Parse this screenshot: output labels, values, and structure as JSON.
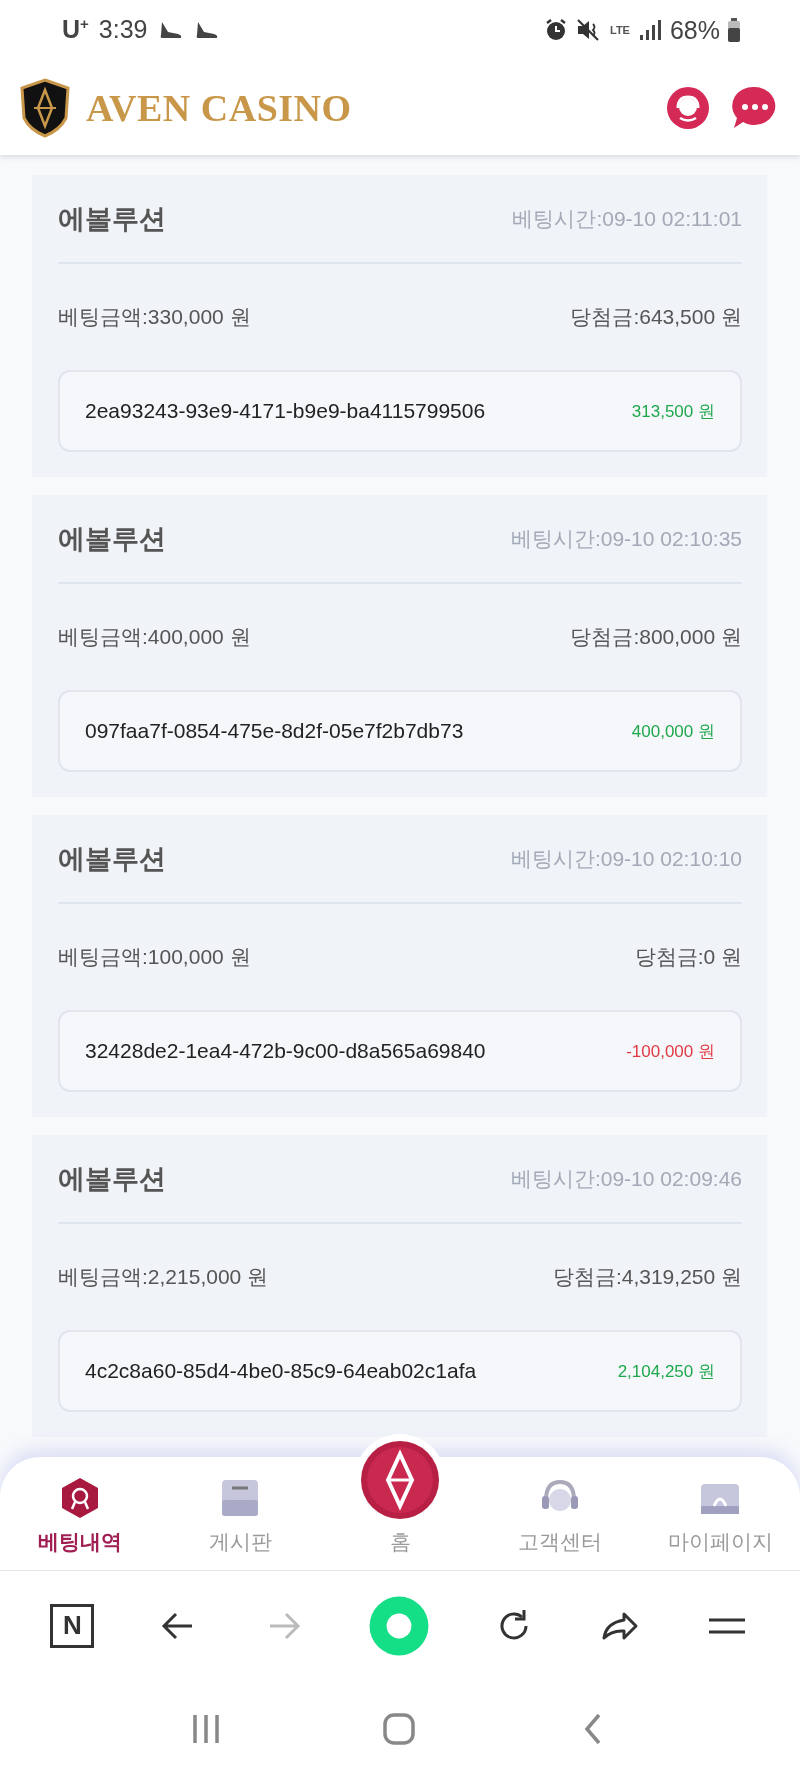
{
  "status_bar": {
    "carrier": "U$^{+}$",
    "time": "3:39",
    "network": "LTE",
    "battery": "68%"
  },
  "header": {
    "title": "AVEN CASINO"
  },
  "bets": [
    {
      "game": "에볼루션",
      "time": "베팅시간:09-10 02:11:01",
      "stake": "베팅금액:330,000 원",
      "payout": "당첨금:643,500 원",
      "round_id": "2ea93243-93e9-4171-b9e9-ba4115799506",
      "profit": "313,500 원",
      "kind": "gain"
    },
    {
      "game": "에볼루션",
      "time": "베팅시간:09-10 02:10:35",
      "stake": "베팅금액:400,000 원",
      "payout": "당첨금:800,000 원",
      "round_id": "097faa7f-0854-475e-8d2f-05e7f2b7db73",
      "profit": "400,000 원",
      "kind": "gain"
    },
    {
      "game": "에볼루션",
      "time": "베팅시간:09-10 02:10:10",
      "stake": "베팅금액:100,000 원",
      "payout": "당첨금:0 원",
      "round_id": "32428de2-1ea4-472b-9c00-d8a565a69840",
      "profit": "-100,000 원",
      "kind": "loss"
    },
    {
      "game": "에볼루션",
      "time": "베팅시간:09-10 02:09:46",
      "stake": "베팅금액:2,215,000 원",
      "payout": "당첨금:4,319,250 원",
      "round_id": "4c2c8a60-85d4-4be0-85c9-64eab02c1afa",
      "profit": "2,104,250 원",
      "kind": "gain"
    }
  ],
  "bottom_nav": [
    {
      "label": "베팅내역",
      "kind": "history",
      "selected": true
    },
    {
      "label": "게시판",
      "kind": "board",
      "selected": false
    },
    {
      "label": "홈",
      "kind": "home",
      "selected": false
    },
    {
      "label": "고객센터",
      "kind": "support",
      "selected": false
    },
    {
      "label": "마이페이지",
      "kind": "mypage",
      "selected": false
    }
  ],
  "browser_bar": {
    "n_button": "N"
  }
}
